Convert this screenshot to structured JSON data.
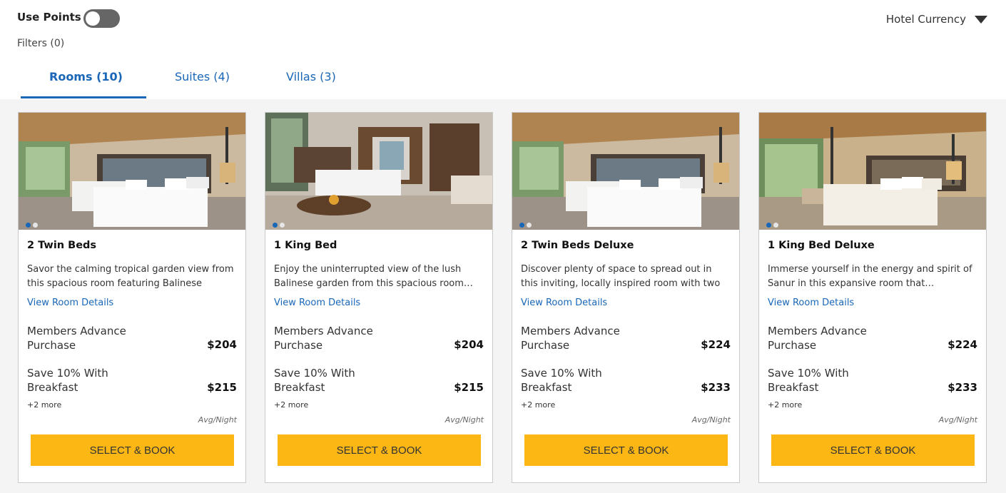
{
  "header": {
    "use_points_label": "Use Points",
    "use_points_on": false,
    "filters_label": "Filters (0)",
    "currency_label": "Hotel Currency"
  },
  "tabs": [
    {
      "label": "Rooms (10)",
      "active": true
    },
    {
      "label": "Suites (4)",
      "active": false
    },
    {
      "label": "Villas (3)",
      "active": false
    }
  ],
  "colors": {
    "accent": "#1a67b8",
    "button": "#fdb715",
    "toggle_off": "#666666"
  },
  "rooms": [
    {
      "title": "2 Twin Beds",
      "description": "Savor the calming tropical garden view from this spacious room featuring Balinese déco…",
      "details_link": "View Room Details",
      "rates": [
        {
          "name": "Members Advance Purchase",
          "price": "$204"
        },
        {
          "name": "Save 10% With Breakfast",
          "price": "$215"
        }
      ],
      "more": "+2 more",
      "avg_label": "Avg/Night",
      "button": "SELECT & BOOK"
    },
    {
      "title": "1 King Bed",
      "description": "Enjoy the uninterrupted view of the lush Balinese garden from this spacious room…",
      "details_link": "View Room Details",
      "rates": [
        {
          "name": "Members Advance Purchase",
          "price": "$204"
        },
        {
          "name": "Save 10% With Breakfast",
          "price": "$215"
        }
      ],
      "more": "+2 more",
      "avg_label": "Avg/Night",
      "button": "SELECT & BOOK"
    },
    {
      "title": "2 Twin Beds Deluxe",
      "description": "Discover plenty of space to spread out in this inviting, locally inspired room with two plus…",
      "details_link": "View Room Details",
      "rates": [
        {
          "name": "Members Advance Purchase",
          "price": "$224"
        },
        {
          "name": "Save 10% With Breakfast",
          "price": "$233"
        }
      ],
      "more": "+2 more",
      "avg_label": "Avg/Night",
      "button": "SELECT & BOOK"
    },
    {
      "title": "1 King Bed Deluxe",
      "description": "Immerse yourself in the energy and spirit of Sanur in this expansive room that…",
      "details_link": "View Room Details",
      "rates": [
        {
          "name": "Members Advance Purchase",
          "price": "$224"
        },
        {
          "name": "Save 10% With Breakfast",
          "price": "$233"
        }
      ],
      "more": "+2 more",
      "avg_label": "Avg/Night",
      "button": "SELECT & BOOK"
    }
  ]
}
